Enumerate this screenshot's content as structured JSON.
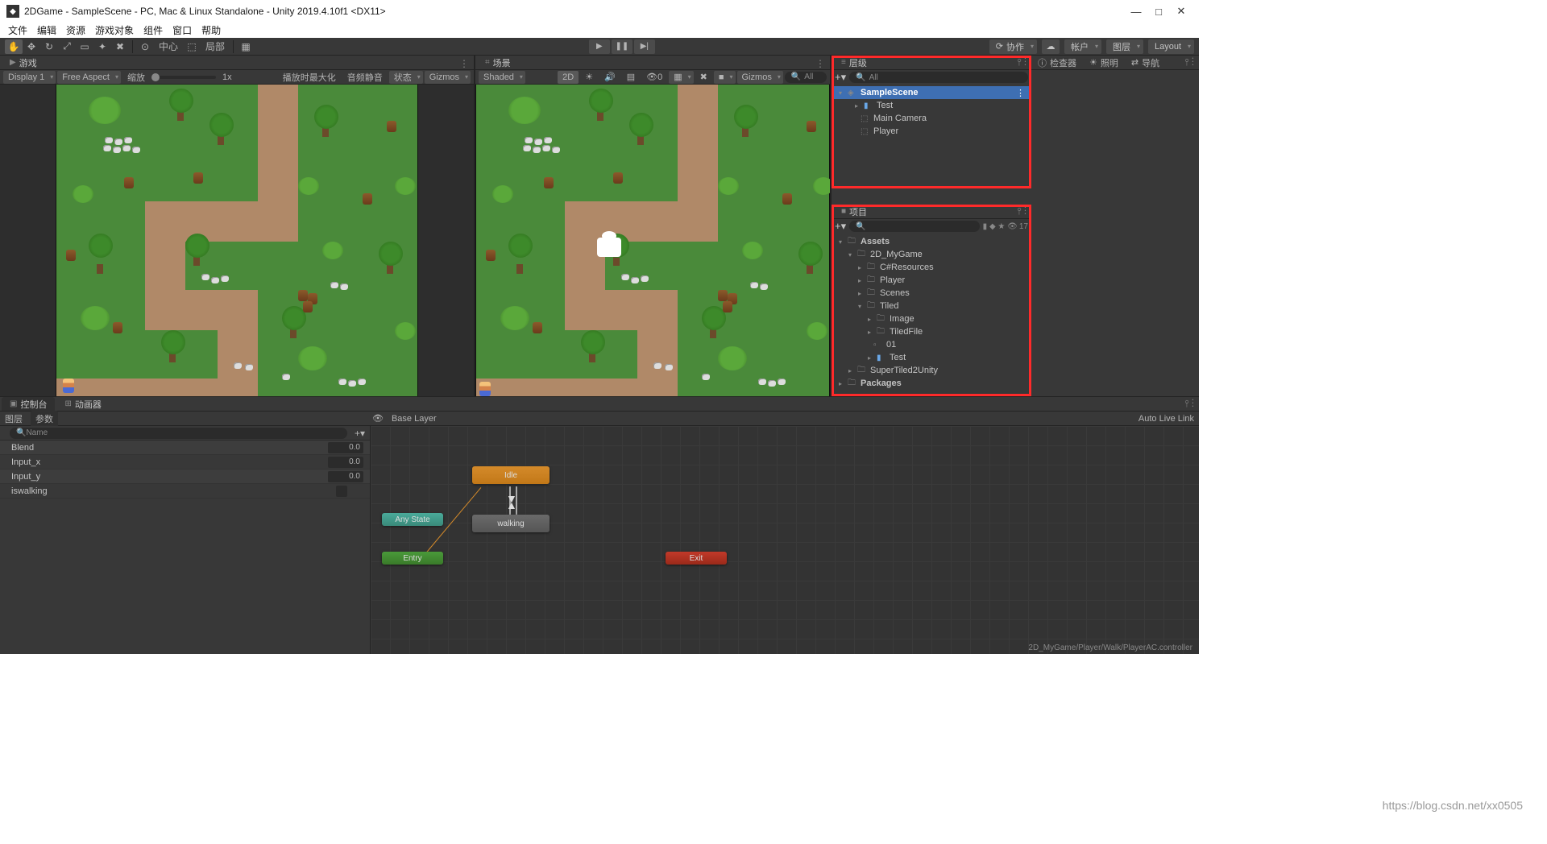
{
  "title": "2DGame - SampleScene - PC, Mac & Linux Standalone - Unity 2019.4.10f1 <DX11>",
  "menu": [
    "文件",
    "编辑",
    "资源",
    "游戏对象",
    "组件",
    "窗口",
    "帮助"
  ],
  "toolbar": {
    "center_label": "中心",
    "local_label": "局部",
    "collab": "协作",
    "account": "帐户",
    "layers": "图层",
    "layout": "Layout"
  },
  "game": {
    "tab": "游戏",
    "display": "Display 1",
    "aspect": "Free Aspect",
    "scale": "缩放",
    "scale_val": "1x",
    "maximize": "播放时最大化",
    "mute": "音频静音",
    "status": "状态",
    "gizmos": "Gizmos"
  },
  "scene": {
    "tab": "场景",
    "shading": "Shaded",
    "twoD": "2D",
    "gizmos": "Gizmos",
    "search_placeholder": "All"
  },
  "hierarchy": {
    "tab": "层级",
    "search_placeholder": "All",
    "root": "SampleScene",
    "items": [
      "Test",
      "Main Camera",
      "Player"
    ]
  },
  "project": {
    "tab": "项目",
    "hidden": "17",
    "root": "Assets",
    "mygame": "2D_MyGame",
    "items": [
      "C#Resources",
      "Player",
      "Scenes"
    ],
    "tiled": "Tiled",
    "tiled_items": [
      "Image",
      "TiledFile",
      "01",
      "Test"
    ],
    "super": "SuperTiled2Unity",
    "packages": "Packages"
  },
  "inspector": {
    "tab": "检查器",
    "lighting": "照明",
    "nav": "导航"
  },
  "console": {
    "tab": "控制台"
  },
  "animator": {
    "tab": "动画器",
    "layers": "图层",
    "params": "参数",
    "base_layer": "Base Layer",
    "auto": "Auto Live Link",
    "param_name_placeholder": "Name",
    "param_rows": [
      {
        "name": "Blend",
        "val": "0.0"
      },
      {
        "name": "Input_x",
        "val": "0.0"
      },
      {
        "name": "Input_y",
        "val": "0.0"
      },
      {
        "name": "iswalking",
        "check": true
      }
    ],
    "nodes": {
      "idle": "Idle",
      "walking": "walking",
      "anystate": "Any State",
      "entry": "Entry",
      "exit": "Exit"
    },
    "path": "2D_MyGame/Player/Walk/PlayerAC.controller"
  },
  "watermark": "https://blog.csdn.net/xx0505"
}
